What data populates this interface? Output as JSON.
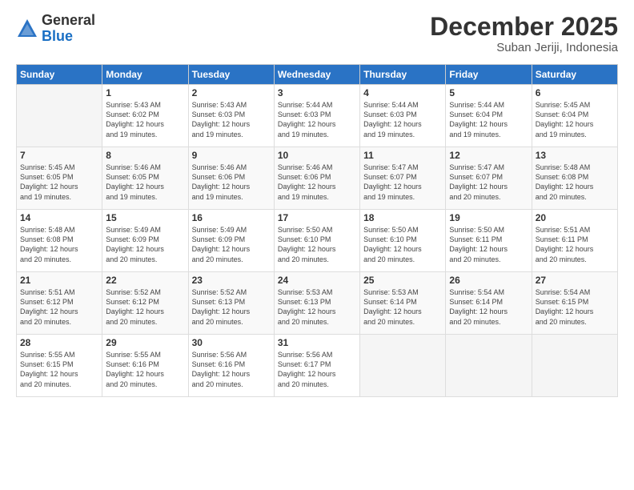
{
  "logo": {
    "general": "General",
    "blue": "Blue"
  },
  "header": {
    "month": "December 2025",
    "location": "Suban Jeriji, Indonesia"
  },
  "weekdays": [
    "Sunday",
    "Monday",
    "Tuesday",
    "Wednesday",
    "Thursday",
    "Friday",
    "Saturday"
  ],
  "weeks": [
    [
      {
        "day": "",
        "info": ""
      },
      {
        "day": "1",
        "info": "Sunrise: 5:43 AM\nSunset: 6:02 PM\nDaylight: 12 hours\nand 19 minutes."
      },
      {
        "day": "2",
        "info": "Sunrise: 5:43 AM\nSunset: 6:03 PM\nDaylight: 12 hours\nand 19 minutes."
      },
      {
        "day": "3",
        "info": "Sunrise: 5:44 AM\nSunset: 6:03 PM\nDaylight: 12 hours\nand 19 minutes."
      },
      {
        "day": "4",
        "info": "Sunrise: 5:44 AM\nSunset: 6:03 PM\nDaylight: 12 hours\nand 19 minutes."
      },
      {
        "day": "5",
        "info": "Sunrise: 5:44 AM\nSunset: 6:04 PM\nDaylight: 12 hours\nand 19 minutes."
      },
      {
        "day": "6",
        "info": "Sunrise: 5:45 AM\nSunset: 6:04 PM\nDaylight: 12 hours\nand 19 minutes."
      }
    ],
    [
      {
        "day": "7",
        "info": "Sunrise: 5:45 AM\nSunset: 6:05 PM\nDaylight: 12 hours\nand 19 minutes."
      },
      {
        "day": "8",
        "info": "Sunrise: 5:46 AM\nSunset: 6:05 PM\nDaylight: 12 hours\nand 19 minutes."
      },
      {
        "day": "9",
        "info": "Sunrise: 5:46 AM\nSunset: 6:06 PM\nDaylight: 12 hours\nand 19 minutes."
      },
      {
        "day": "10",
        "info": "Sunrise: 5:46 AM\nSunset: 6:06 PM\nDaylight: 12 hours\nand 19 minutes."
      },
      {
        "day": "11",
        "info": "Sunrise: 5:47 AM\nSunset: 6:07 PM\nDaylight: 12 hours\nand 19 minutes."
      },
      {
        "day": "12",
        "info": "Sunrise: 5:47 AM\nSunset: 6:07 PM\nDaylight: 12 hours\nand 20 minutes."
      },
      {
        "day": "13",
        "info": "Sunrise: 5:48 AM\nSunset: 6:08 PM\nDaylight: 12 hours\nand 20 minutes."
      }
    ],
    [
      {
        "day": "14",
        "info": "Sunrise: 5:48 AM\nSunset: 6:08 PM\nDaylight: 12 hours\nand 20 minutes."
      },
      {
        "day": "15",
        "info": "Sunrise: 5:49 AM\nSunset: 6:09 PM\nDaylight: 12 hours\nand 20 minutes."
      },
      {
        "day": "16",
        "info": "Sunrise: 5:49 AM\nSunset: 6:09 PM\nDaylight: 12 hours\nand 20 minutes."
      },
      {
        "day": "17",
        "info": "Sunrise: 5:50 AM\nSunset: 6:10 PM\nDaylight: 12 hours\nand 20 minutes."
      },
      {
        "day": "18",
        "info": "Sunrise: 5:50 AM\nSunset: 6:10 PM\nDaylight: 12 hours\nand 20 minutes."
      },
      {
        "day": "19",
        "info": "Sunrise: 5:50 AM\nSunset: 6:11 PM\nDaylight: 12 hours\nand 20 minutes."
      },
      {
        "day": "20",
        "info": "Sunrise: 5:51 AM\nSunset: 6:11 PM\nDaylight: 12 hours\nand 20 minutes."
      }
    ],
    [
      {
        "day": "21",
        "info": "Sunrise: 5:51 AM\nSunset: 6:12 PM\nDaylight: 12 hours\nand 20 minutes."
      },
      {
        "day": "22",
        "info": "Sunrise: 5:52 AM\nSunset: 6:12 PM\nDaylight: 12 hours\nand 20 minutes."
      },
      {
        "day": "23",
        "info": "Sunrise: 5:52 AM\nSunset: 6:13 PM\nDaylight: 12 hours\nand 20 minutes."
      },
      {
        "day": "24",
        "info": "Sunrise: 5:53 AM\nSunset: 6:13 PM\nDaylight: 12 hours\nand 20 minutes."
      },
      {
        "day": "25",
        "info": "Sunrise: 5:53 AM\nSunset: 6:14 PM\nDaylight: 12 hours\nand 20 minutes."
      },
      {
        "day": "26",
        "info": "Sunrise: 5:54 AM\nSunset: 6:14 PM\nDaylight: 12 hours\nand 20 minutes."
      },
      {
        "day": "27",
        "info": "Sunrise: 5:54 AM\nSunset: 6:15 PM\nDaylight: 12 hours\nand 20 minutes."
      }
    ],
    [
      {
        "day": "28",
        "info": "Sunrise: 5:55 AM\nSunset: 6:15 PM\nDaylight: 12 hours\nand 20 minutes."
      },
      {
        "day": "29",
        "info": "Sunrise: 5:55 AM\nSunset: 6:16 PM\nDaylight: 12 hours\nand 20 minutes."
      },
      {
        "day": "30",
        "info": "Sunrise: 5:56 AM\nSunset: 6:16 PM\nDaylight: 12 hours\nand 20 minutes."
      },
      {
        "day": "31",
        "info": "Sunrise: 5:56 AM\nSunset: 6:17 PM\nDaylight: 12 hours\nand 20 minutes."
      },
      {
        "day": "",
        "info": ""
      },
      {
        "day": "",
        "info": ""
      },
      {
        "day": "",
        "info": ""
      }
    ]
  ]
}
